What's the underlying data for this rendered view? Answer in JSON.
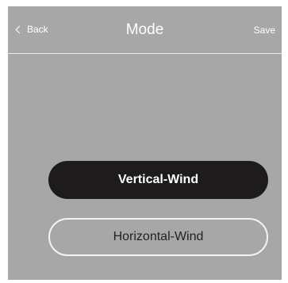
{
  "header": {
    "back_label": "Back",
    "title": "Mode",
    "save_label": "Save"
  },
  "modes": [
    {
      "label": "Vertical-Wind",
      "selected": true
    },
    {
      "label": "Horizontal-Wind",
      "selected": false
    }
  ],
  "colors": {
    "background": "#a7a7a7",
    "selected_button": "#1d1b1b",
    "outline": "#f3f3f3",
    "text_light": "#ffffff",
    "text_dark": "#222222"
  }
}
